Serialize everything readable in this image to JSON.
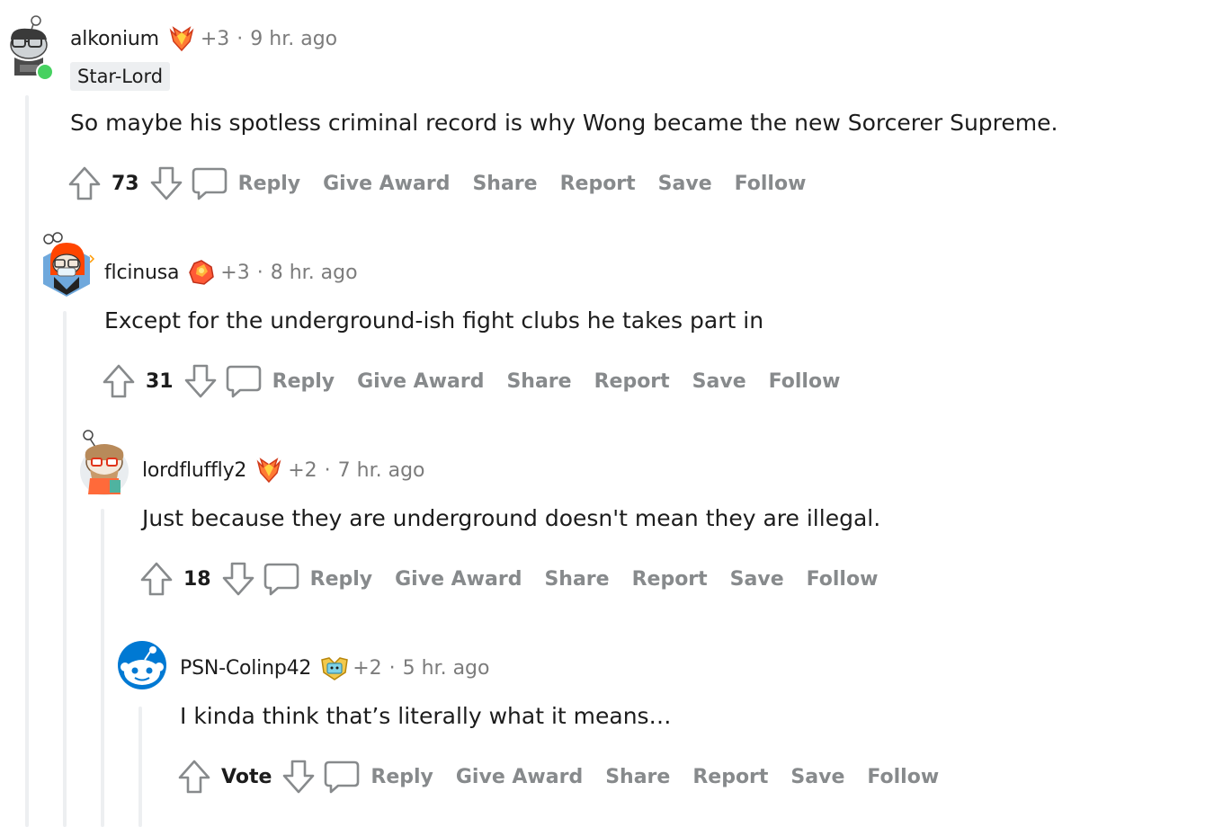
{
  "comments": [
    {
      "username": "alkonium",
      "award_count": "+3",
      "separator": "·",
      "time": "9 hr. ago",
      "flair": "Star-Lord",
      "text": "So maybe his spotless criminal record is why Wong became the new Sorcerer Supreme.",
      "score": "73",
      "online": true
    },
    {
      "username": "flcinusa",
      "award_count": "+3",
      "separator": "·",
      "time": "8 hr. ago",
      "text": "Except for the underground-ish fight clubs he takes part in",
      "score": "31"
    },
    {
      "username": "lordfluffly2",
      "award_count": "+2",
      "separator": "·",
      "time": "7 hr. ago",
      "text": "Just because they are underground doesn't mean they are illegal.",
      "score": "18"
    },
    {
      "username": "PSN-Colinp42",
      "award_count": "+2",
      "separator": "·",
      "time": "5 hr. ago",
      "text": "I kinda think that’s literally what it means…",
      "score": "Vote"
    }
  ],
  "actions": {
    "reply": "Reply",
    "give_award": "Give Award",
    "share": "Share",
    "report": "Report",
    "save": "Save",
    "follow": "Follow"
  },
  "colors": {
    "meta_gray": "#7c7c7c",
    "action_gray": "#878a8c",
    "thread_line": "#edeff1",
    "online_green": "#46d160",
    "flair_bg": "#edeff1"
  },
  "icons": {
    "upvote": "upvote-arrow-icon",
    "downvote": "downvote-arrow-icon",
    "reply": "speech-bubble-icon",
    "award": "award-icon"
  }
}
